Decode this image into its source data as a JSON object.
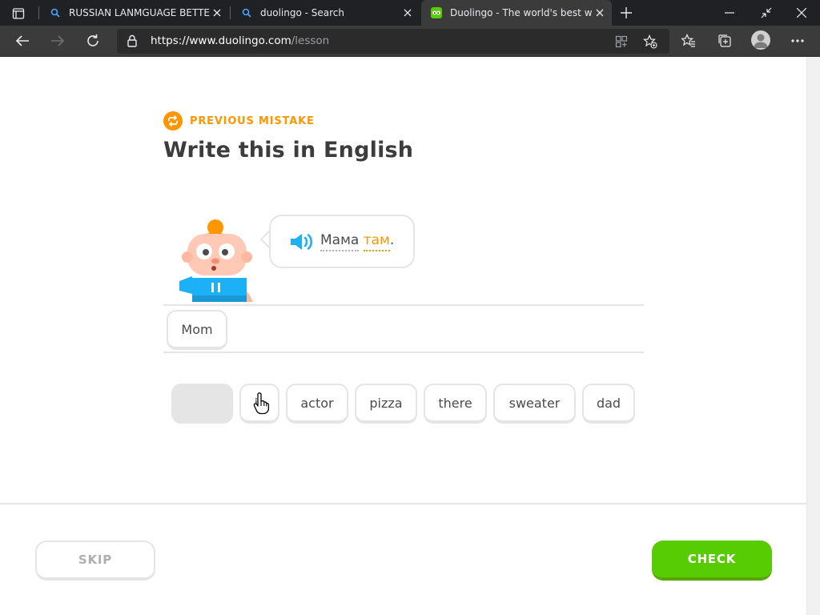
{
  "browser": {
    "tabs": [
      {
        "title": "RUSSIAN LANMGUAGE BETTER I",
        "active": false
      },
      {
        "title": "duolingo - Search",
        "active": false
      },
      {
        "title": "Duolingo - The world's best way",
        "active": true
      }
    ],
    "url_host": "https://www.duolingo.com",
    "url_path": "/lesson"
  },
  "lesson": {
    "badge": "PREVIOUS MISTAKE",
    "title": "Write this in English",
    "prompt_word1": "Мама",
    "prompt_word2": "там",
    "prompt_punct": ".",
    "answer_chips": [
      "Mom"
    ],
    "word_bank": [
      "",
      "is",
      "actor",
      "pizza",
      "there",
      "sweater",
      "dad"
    ]
  },
  "footer": {
    "skip_label": "SKIP",
    "check_label": "CHECK"
  },
  "colors": {
    "accent_orange": "#ff9600",
    "check_green": "#58cc02",
    "speaker_blue": "#1cb0f6"
  }
}
